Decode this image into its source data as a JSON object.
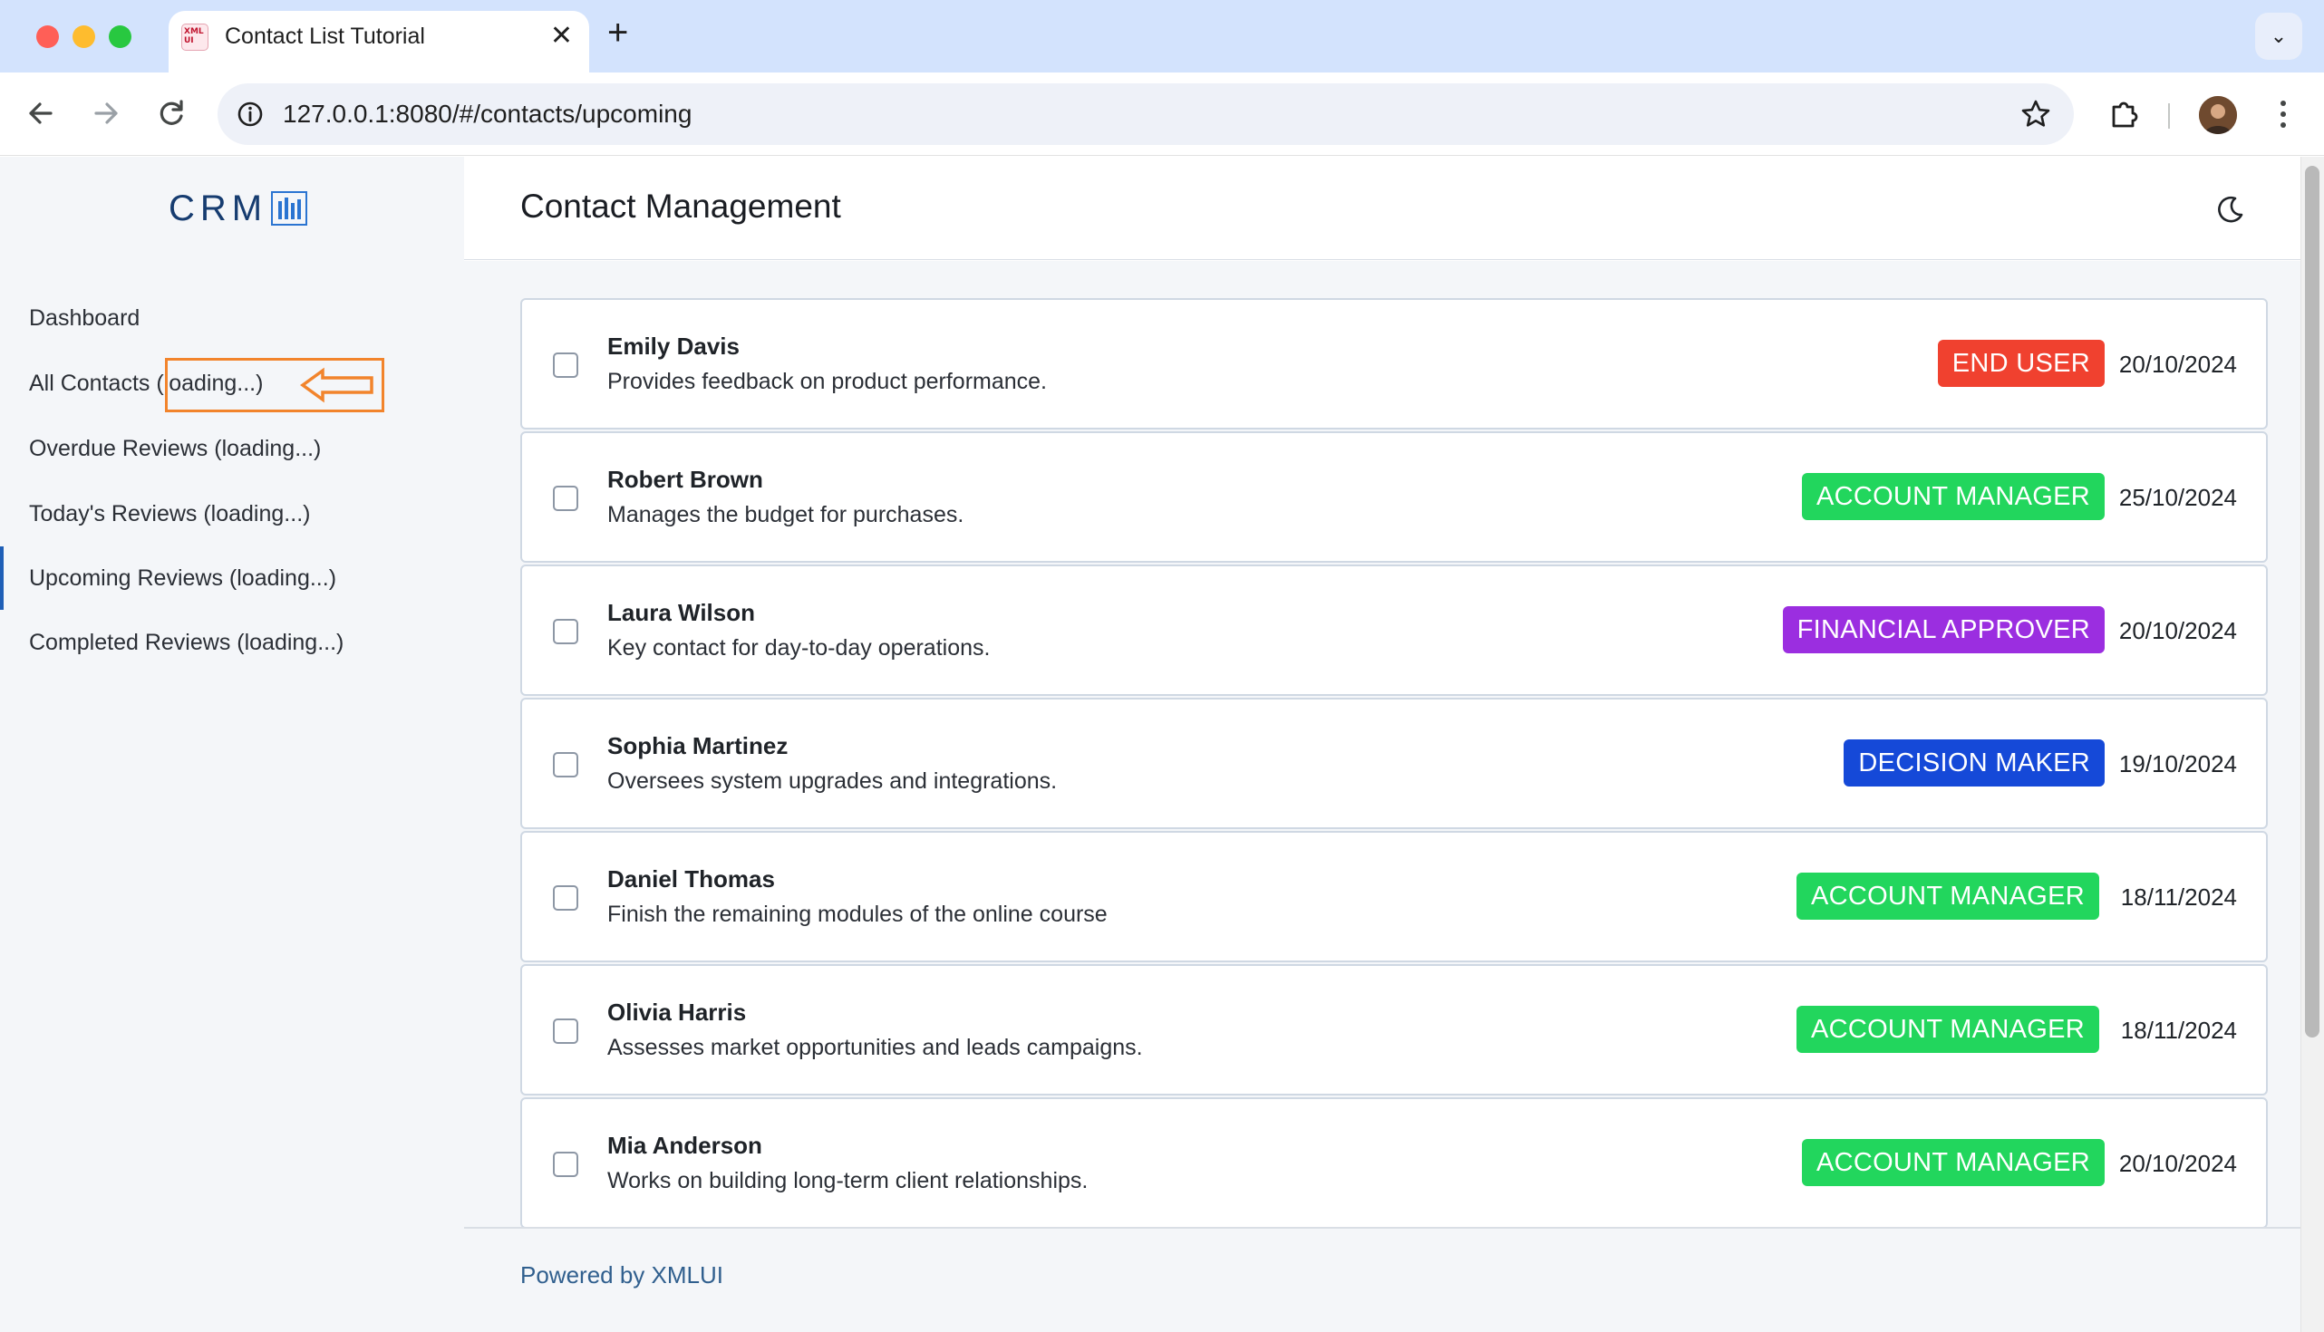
{
  "browser": {
    "tab_title": "Contact List Tutorial",
    "favicon_text": "XML UI",
    "url": "127.0.0.1:8080/#/contacts/upcoming"
  },
  "sidebar": {
    "logo_text": "CRM",
    "items": [
      {
        "label": "Dashboard"
      },
      {
        "label": "All Contacts (loading...)"
      },
      {
        "label": "Overdue Reviews (loading...)"
      },
      {
        "label": "Today's Reviews (loading...)"
      },
      {
        "label": "Upcoming Reviews (loading...)"
      },
      {
        "label": "Completed Reviews (loading...)"
      }
    ],
    "active_item": "Upcoming Reviews (loading...)"
  },
  "header": {
    "title": "Contact Management"
  },
  "contacts": [
    {
      "name": "Emily Davis",
      "description": "Provides feedback on product performance.",
      "role": "END USER",
      "role_color": "#f0412f",
      "date": "20/10/2024"
    },
    {
      "name": "Robert Brown",
      "description": "Manages the budget for purchases.",
      "role": "ACCOUNT MANAGER",
      "role_color": "#22d65d",
      "date": "25/10/2024"
    },
    {
      "name": "Laura Wilson",
      "description": "Key contact for day-to-day operations.",
      "role": "FINANCIAL APPROVER",
      "role_color": "#9b2ee0",
      "date": "20/10/2024"
    },
    {
      "name": "Sophia Martinez",
      "description": "Oversees system upgrades and integrations.",
      "role": "DECISION MAKER",
      "role_color": "#1549d8",
      "date": "19/10/2024"
    },
    {
      "name": "Daniel Thomas",
      "description": "Finish the remaining modules of the online course",
      "role": "ACCOUNT MANAGER",
      "role_color": "#22d65d",
      "date": "18/11/2024"
    },
    {
      "name": "Olivia Harris",
      "description": "Assesses market opportunities and leads campaigns.",
      "role": "ACCOUNT MANAGER",
      "role_color": "#22d65d",
      "date": "18/11/2024"
    },
    {
      "name": "Mia Anderson",
      "description": "Works on building long-term client relationships.",
      "role": "ACCOUNT MANAGER",
      "role_color": "#22d65d",
      "date": "20/10/2024"
    }
  ],
  "footer": {
    "text": "Powered by XMLUI"
  },
  "annotation_color": "#f2842c"
}
